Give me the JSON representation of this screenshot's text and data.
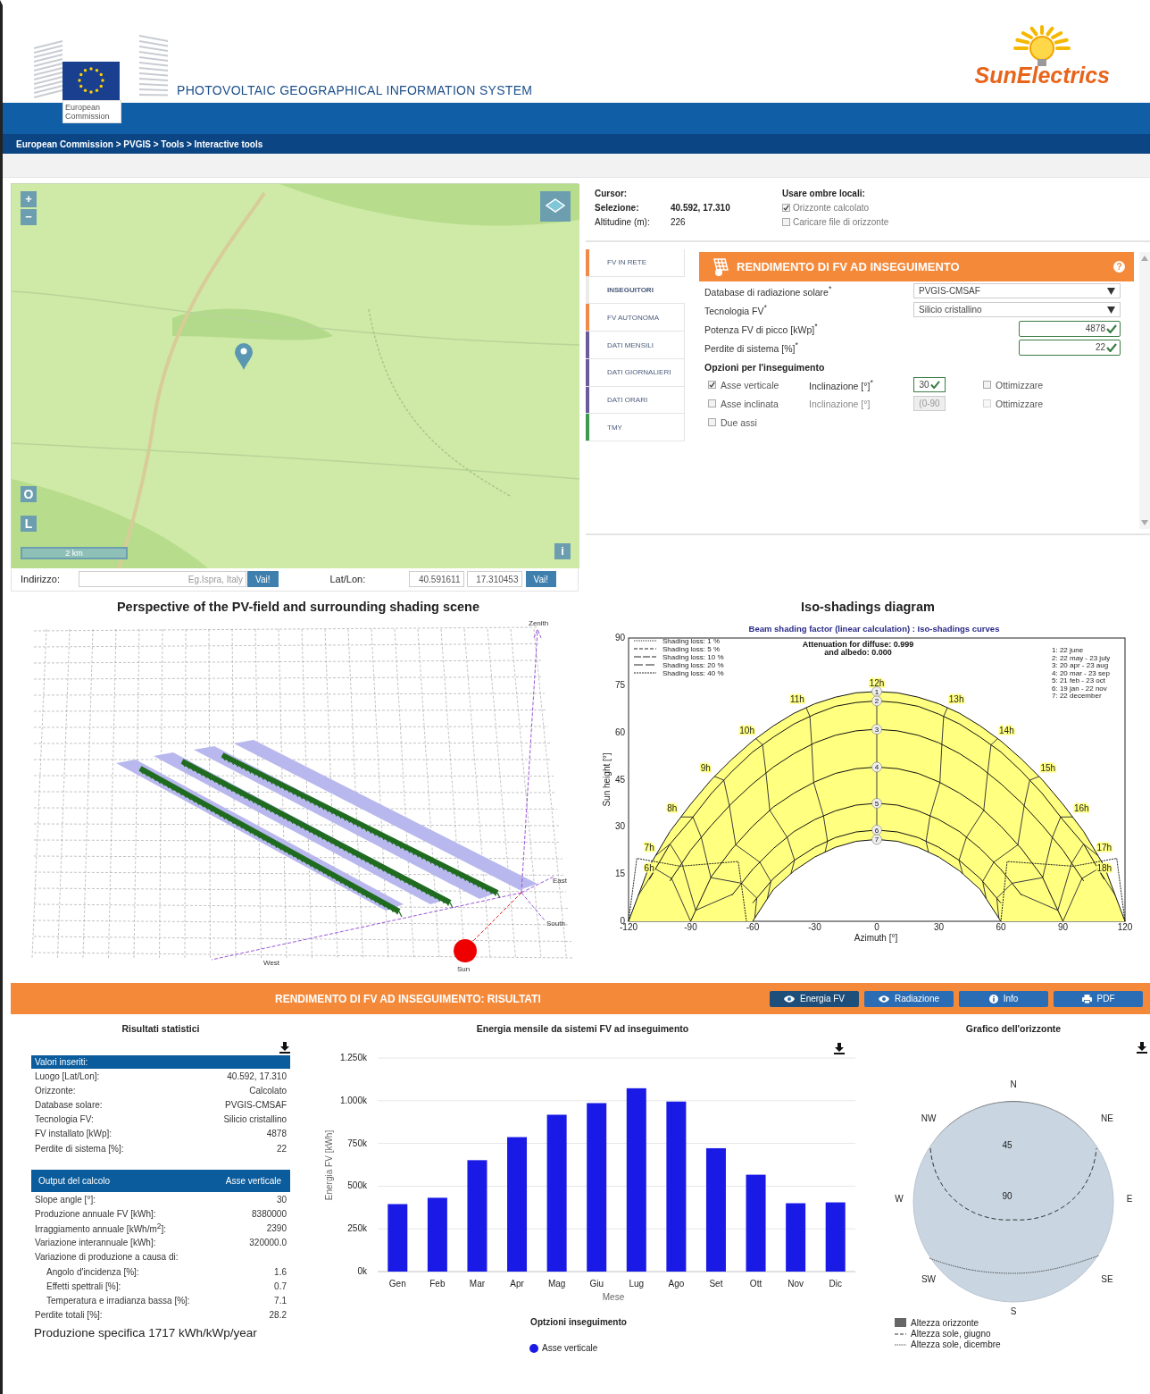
{
  "header": {
    "logo_caption": "European Commission",
    "title": "PHOTOVOLTAIC GEOGRAPHICAL INFORMATION SYSTEM",
    "brand": "SunElectrics"
  },
  "breadcrumb": "European Commission > PVGIS > Tools > Interactive tools",
  "map": {
    "zoom_in": "+",
    "zoom_out": "−",
    "buttons": [
      "O",
      "L"
    ],
    "scale": "2 km",
    "info": "i"
  },
  "address_bar": {
    "address_label": "Indirizzo:",
    "address_placeholder": "Eg.Ispra, Italy",
    "address_go": "Vai!",
    "latlon_label": "Lat/Lon:",
    "lat": "40.591611",
    "lon": "17.310453",
    "latlon_go": "Vai!"
  },
  "location": {
    "cursor_label": "Cursor:",
    "selection_label": "Selezione:",
    "selection": "40.592, 17.310",
    "altitude_label": "Altitudine (m):",
    "altitude": "226",
    "shadows_title": "Usare ombre locali:",
    "options": [
      {
        "label": "Orizzonte calcolato",
        "checked": true
      },
      {
        "label": "Caricare file di orizzonte",
        "checked": false
      }
    ]
  },
  "tabs": [
    {
      "label": "FV IN RETE",
      "color": "#f0894a",
      "selected": false
    },
    {
      "label": "INSEGUITORI",
      "color": "#e6e6e6",
      "selected": true
    },
    {
      "label": "FV AUTONOMA",
      "color": "#f0894a",
      "selected": false
    },
    {
      "label": "DATI MENSILI",
      "color": "#6b5b9a",
      "selected": false
    },
    {
      "label": "DATI GIORNALIERI",
      "color": "#6b5b9a",
      "selected": false
    },
    {
      "label": "DATI ORARI",
      "color": "#6b5b9a",
      "selected": false
    },
    {
      "label": "TMY",
      "color": "#3b9a4b",
      "selected": false
    }
  ],
  "form": {
    "title": "RENDIMENTO DI FV AD INSEGUIMENTO",
    "help": "?",
    "fields": [
      {
        "label": "Database di radiazione solare$^{*}$",
        "kind": "select",
        "value": "PVGIS-CMSAF"
      },
      {
        "label": "Tecnologia FV$^{*}$",
        "kind": "select",
        "value": "Silicio cristallino"
      },
      {
        "label": "Potenza FV di picco [kWp]$^{*}$",
        "kind": "input",
        "value": "4878",
        "valid": true
      },
      {
        "label": "Perdite di sistema [%]$^{*}$",
        "kind": "input",
        "value": "22",
        "valid": true
      }
    ],
    "tracking_title": "Opzioni per l'inseguimento",
    "tracking": [
      {
        "label": "Asse verticale",
        "checked": true,
        "angle_label": "Inclinazione [°]$^{*}$",
        "angle_value": "30",
        "angle_valid": true,
        "angle_disabled": false,
        "optimize_label": "Ottimizzare",
        "optimize_checked": false,
        "optimize_disabled": false
      },
      {
        "label": "Asse inclinata",
        "checked": false,
        "angle_label": "Inclinazione [°]",
        "angle_placeholder": "(0-90",
        "angle_disabled": true,
        "optimize_label": "Ottimizzare",
        "optimize_checked": false,
        "optimize_disabled": true
      },
      {
        "label": "Due assi",
        "checked": false
      }
    ]
  },
  "perspective": {
    "title": "Perspective of the PV-field and surrounding shading scene",
    "zenith": "Zenith",
    "east": "East",
    "south": "South",
    "west": "West",
    "sun": "Sun"
  },
  "iso": {
    "title": "Iso-shadings diagram",
    "attenuation": "Attenuation for diffuse: 0.999",
    "albedo": "and albedo: 0.000",
    "legend": [
      "Shading loss: 1 %",
      "Shading loss: 5 %",
      "Shading loss: 10 %",
      "Shading loss: 20 %",
      "Shading loss: 40 %"
    ],
    "dates": [
      "1: 22 june",
      "2: 22 may - 23 july",
      "3: 20 apr - 23 aug",
      "4: 20 mar - 23 sep",
      "5: 21 feb - 23 oct",
      "6: 19 jan - 22 nov",
      "7: 22 december"
    ],
    "date_markers": [
      "1",
      "2",
      "3",
      "4",
      "5",
      "6",
      "7"
    ],
    "hours": [
      "6h",
      "7h",
      "8h",
      "9h",
      "10h",
      "11h",
      "12h",
      "13h",
      "14h",
      "15h",
      "16h",
      "17h",
      "18h"
    ],
    "chart_data": {
      "type": "line",
      "title": "Beam shading factor (linear calculation) : Iso-shadings curves",
      "xlabel": "Azimuth [°]",
      "ylabel": "Sun height [°]",
      "x": [
        -120,
        -110,
        -100,
        -90,
        -80,
        -70,
        -60,
        -50,
        -40,
        -30,
        -20,
        -10,
        0,
        10,
        20,
        30,
        40,
        50,
        60,
        70,
        80,
        90,
        100,
        110,
        120
      ],
      "series": [
        {
          "color": "#111111",
          "values": [
            0,
            17.5,
            28.5,
            37.2,
            45.0,
            51.5,
            57.3,
            62.1,
            66.1,
            69.1,
            71.2,
            72.6,
            73,
            72.6,
            71.2,
            69.1,
            66.1,
            62.1,
            57.3,
            51.5,
            45.0,
            37.2,
            28.5,
            17.5,
            0
          ]
        },
        {
          "color": "#111111",
          "values": [
            null,
            13.3,
            24.5,
            32.2,
            40.6,
            47.6,
            53.8,
            58.5,
            62.7,
            65.8,
            68.3,
            69.5,
            70,
            69.5,
            68.3,
            65.8,
            62.7,
            58.5,
            53.8,
            47.6,
            40.6,
            32.2,
            24.5,
            13.3,
            null
          ]
        },
        {
          "color": "#111111",
          "values": [
            null,
            null,
            12.8,
            22.6,
            30.5,
            37.6,
            43.7,
            49.0,
            53.3,
            56.7,
            59.1,
            60.5,
            61,
            60.5,
            59.1,
            56.7,
            53.3,
            49.0,
            43.7,
            37.6,
            30.5,
            22.6,
            12.8,
            null,
            null
          ]
        },
        {
          "color": "#111111",
          "values": [
            null,
            null,
            null,
            0,
            14.2,
            23.0,
            30.2,
            36.3,
            40.7,
            44.3,
            47.0,
            48.5,
            49,
            48.5,
            47.0,
            44.3,
            40.7,
            36.3,
            30.2,
            23.0,
            14.2,
            0,
            null,
            null,
            null
          ]
        },
        {
          "color": "#111111",
          "values": [
            null,
            null,
            null,
            null,
            null,
            8.3,
            16.5,
            23.1,
            28.5,
            32.3,
            35.1,
            36.9,
            37.5,
            36.9,
            35.1,
            32.3,
            28.5,
            23.1,
            16.5,
            8.3,
            null,
            null,
            null,
            null,
            null
          ]
        },
        {
          "color": "#111111",
          "values": [
            null,
            null,
            null,
            null,
            null,
            null,
            5.8,
            13.6,
            19.3,
            23.5,
            26.6,
            28.4,
            29,
            28.4,
            26.6,
            23.5,
            19.3,
            13.6,
            5.8,
            null,
            null,
            null,
            null,
            null,
            null
          ]
        },
        {
          "color": "#111111",
          "values": [
            null,
            null,
            null,
            null,
            null,
            null,
            0,
            10.1,
            16.0,
            20.4,
            23.5,
            25.4,
            26,
            25.4,
            23.5,
            20.4,
            16.0,
            10.1,
            0,
            null,
            null,
            null,
            null,
            null,
            null
          ]
        }
      ],
      "xlim": [
        -120,
        120
      ],
      "ylim": [
        0,
        90
      ],
      "xticks": [
        -120,
        -90,
        -60,
        -30,
        0,
        30,
        60,
        90,
        120
      ],
      "yticks": [
        0,
        15,
        30,
        45,
        60,
        75,
        90
      ]
    }
  },
  "results": {
    "title": "RENDIMENTO DI FV AD INSEGUIMENTO: RISULTATI",
    "buttons": [
      {
        "label": "Energia FV",
        "kind": "view",
        "selected": true
      },
      {
        "label": "Radiazione",
        "kind": "view",
        "selected": false
      },
      {
        "label": "Info",
        "kind": "help",
        "selected": false
      },
      {
        "label": "PDF",
        "kind": "export",
        "selected": false
      }
    ]
  },
  "stats": {
    "title": "Risultati statistici",
    "inputs_header": "Valori inseriti:",
    "inputs": [
      {
        "label": "Luogo [Lat/Lon]:",
        "value": "40.592, 17.310"
      },
      {
        "label": "Orizzonte:",
        "value": "Calcolato"
      },
      {
        "label": "Database solare:",
        "value": "PVGIS-CMSAF"
      },
      {
        "label": "Tecnologia FV:",
        "value": "Silicio cristallino"
      },
      {
        "label": "FV installato [kWp]:",
        "value": "4878"
      },
      {
        "label": "Perdite di sistema [%]:",
        "value": "22"
      }
    ],
    "output_header": "Output del calcolo",
    "output_column": "Asse verticale",
    "outputs": [
      {
        "label": "Slope angle [°]:",
        "value": "30"
      },
      {
        "label": "Produzione annuale FV [kWh]:",
        "value": "8380000"
      },
      {
        "label": "Irraggiamento annuale [kWh/m$^{2}$]:",
        "value": "2390"
      },
      {
        "label": "Variazione interannuale [kWh]:",
        "value": "320000.0"
      },
      {
        "label": "Variazione di produzione a causa di:",
        "children": [
          {
            "label": "Angolo d'incidenza [%]:",
            "value": "1.6"
          },
          {
            "label": "Effetti spettrali [%]:",
            "value": "0.7"
          },
          {
            "label": "Temperatura e irradianza bassa [%]:",
            "value": "7.1"
          }
        ]
      },
      {
        "label": "Perdite totali [%]:",
        "value": "28.2"
      }
    ],
    "specific": "Produzione specifica 1717 kWh/kWp/year"
  },
  "monthly": {
    "title": "Energia mensile da sistemi FV ad inseguimento",
    "legend_title": "Optzioni inseguimento",
    "chart_data": {
      "type": "bar",
      "xlabel": "Mese",
      "ylabel": "Energia FV [kWh]",
      "grid": true,
      "categories": [
        "Gen",
        "Feb",
        "Mar",
        "Apr",
        "Mag",
        "Giu",
        "Lug",
        "Ago",
        "Set",
        "Ott",
        "Nov",
        "Dic"
      ],
      "series": [
        {
          "name": "Asse verticale",
          "color": "#1a1ae6",
          "values": [
            395,
            432,
            652,
            787,
            918,
            986,
            1073,
            995,
            722,
            567,
            400,
            405
          ]
        }
      ],
      "ylim": [
        0,
        1250
      ],
      "yticks": [
        {
          "value": 0,
          "label": "0k"
        },
        {
          "value": 250,
          "label": "250k"
        },
        {
          "value": 500,
          "label": "500k"
        },
        {
          "value": 750,
          "label": "750k"
        },
        {
          "value": 1000,
          "label": "1.000k"
        },
        {
          "value": 1250,
          "label": "1.250k"
        }
      ]
    }
  },
  "horizon": {
    "title": "Grafico dell'orizzonte",
    "directions": [
      "N",
      "NE",
      "E",
      "SE",
      "S",
      "SW",
      "W",
      "NW"
    ],
    "rings": [
      "45",
      "90"
    ],
    "legend": [
      {
        "label": "Altezza orizzonte",
        "kind": "area"
      },
      {
        "label": "Altezza sole, giugno",
        "kind": "dashed"
      },
      {
        "label": "Altezza sole, dicembre",
        "kind": "dotted"
      }
    ]
  }
}
